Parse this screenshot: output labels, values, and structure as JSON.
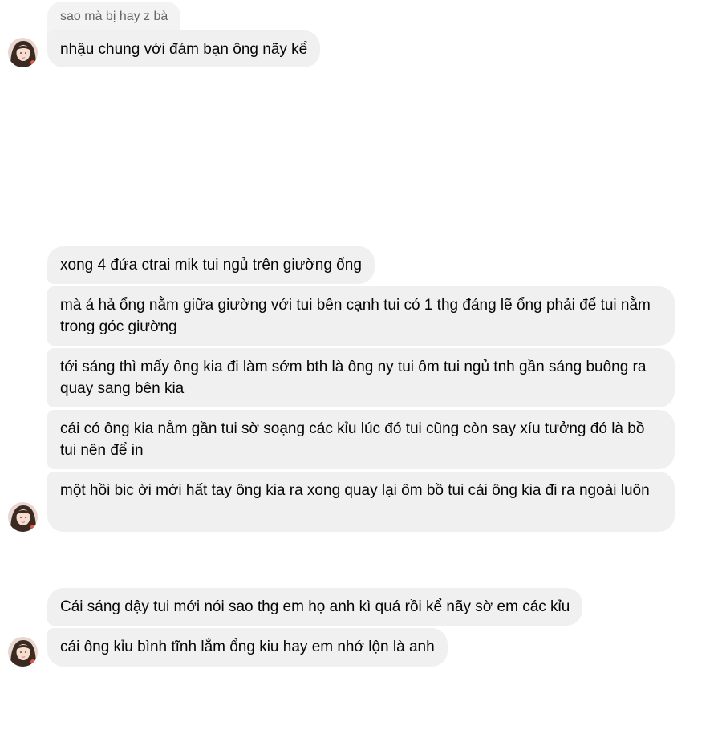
{
  "chat": {
    "reply_preview": "sao mà bị hay z bà",
    "groups": [
      {
        "messages": [
          "nhậu chung với đám bạn ông nãy kể"
        ]
      },
      {
        "messages": [
          "xong 4 đứa ctrai mik tui ngủ trên giường ổng",
          "mà á hả ổng nằm giữa giường với tui bên cạnh tui có 1 thg đáng lẽ ổng phải để tui nằm trong góc giường",
          "tới sáng thì mấy ông kia đi làm sớm bth là ông ny tui ôm tui ngủ tnh gần sáng buông ra quay sang bên kia",
          "cái có ông kia nằm gần tui sờ soạng các kỉu lúc đó tui cũng còn say xíu tưởng đó là bồ tui nên để in",
          "một hồi bic ời mới hất tay ông kia ra xong quay lại ôm bồ tui cái ông kia đi ra ngoài luôn"
        ]
      },
      {
        "messages": [
          "Cái sáng dậy tui mới nói sao thg em họ anh kì quá rồi kể nãy sờ em các kỉu",
          "cái ông kỉu bình tĩnh lắm ổng kiu hay em nhớ lộn là anh"
        ]
      }
    ],
    "bubble_color": "#f0f0f0",
    "avatar_icon": "profile-photo-avatar"
  }
}
